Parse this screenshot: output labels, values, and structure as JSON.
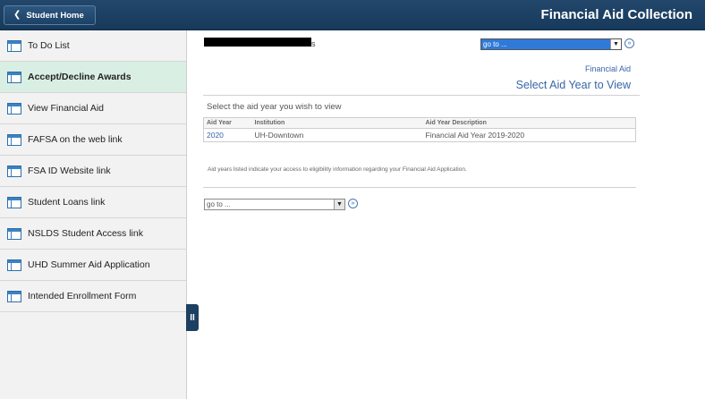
{
  "header": {
    "home_label": "Student Home",
    "title": "Financial Aid Collection"
  },
  "sidebar": {
    "items": [
      {
        "label": "To Do List",
        "selected": false
      },
      {
        "label": "Accept/Decline Awards",
        "selected": true
      },
      {
        "label": "View Financial Aid",
        "selected": false
      },
      {
        "label": "FAFSA on the web link",
        "selected": false
      },
      {
        "label": "FSA ID Website link",
        "selected": false
      },
      {
        "label": "Student Loans link",
        "selected": false
      },
      {
        "label": "NSLDS Student Access link",
        "selected": false
      },
      {
        "label": "UHD Summer Aid Application",
        "selected": false
      },
      {
        "label": "Intended Enrollment Form",
        "selected": false
      }
    ],
    "collapse_glyph": "II"
  },
  "main": {
    "name_suffix": "s",
    "goto_top": {
      "value": "go to ..."
    },
    "go_glyph": "»",
    "financial_aid_link": "Financial Aid",
    "page_title": "Select Aid Year to View",
    "select_prompt": "Select the aid year you wish to view",
    "table": {
      "headers": [
        "Aid Year",
        "Institution",
        "Aid Year Description"
      ],
      "rows": [
        [
          "2020",
          "UH-Downtown",
          "Financial Aid Year 2019-2020"
        ]
      ]
    },
    "note": "Aid years listed indicate your access to eligibility information regarding your Financial Aid Application.",
    "goto_bottom": {
      "value": "go to ..."
    }
  },
  "colors": {
    "header_bg": "#1d4166",
    "selected_item_bg": "#d9efe3",
    "link": "#3766a8",
    "goto_top_highlight": "#2f7ad8"
  }
}
